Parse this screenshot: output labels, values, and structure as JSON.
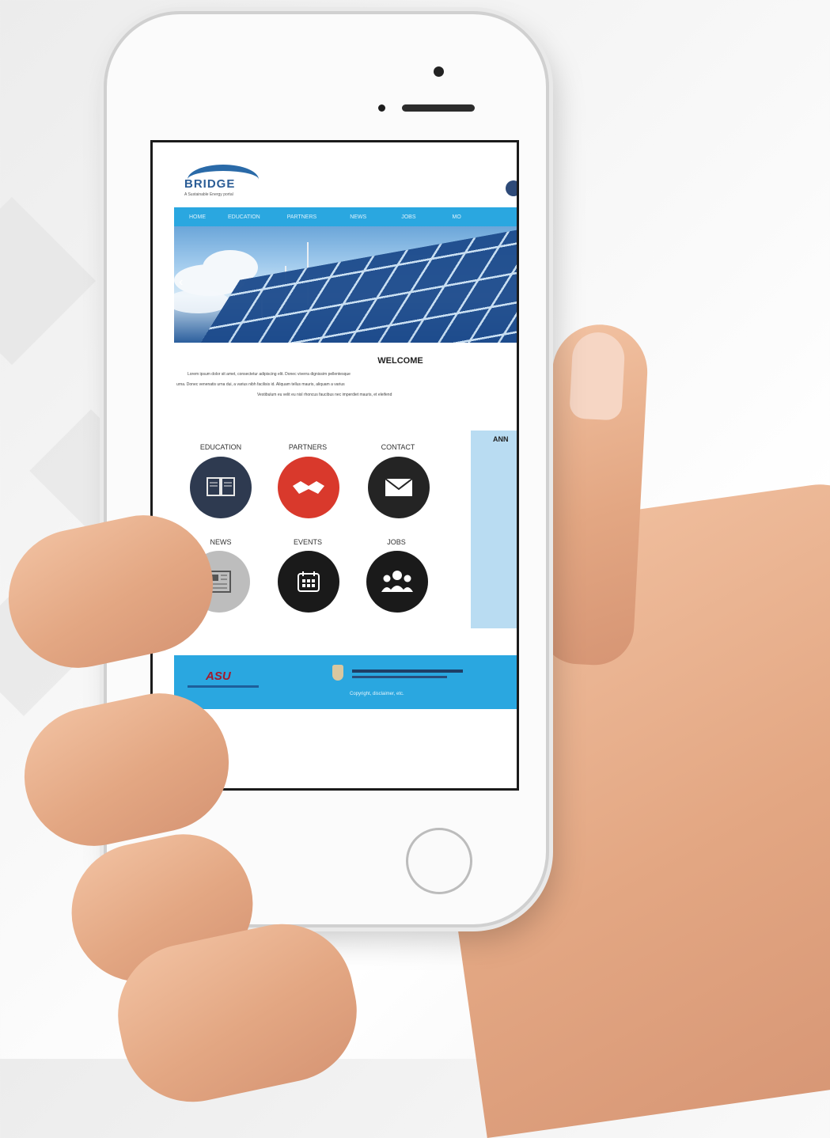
{
  "site": {
    "logo_text": "BRIDGE",
    "logo_subtitle": "A Sustainable Energy portal",
    "nav": [
      "HOME",
      "EDUCATION",
      "PARTNERS",
      "NEWS",
      "JOBS",
      "MO"
    ],
    "welcome": {
      "title": "WELCOME",
      "lines": [
        "Lorem ipsum dolor sit amet, consectetur adipiscing elit. Donec viverra dignissim pellentesque",
        "urna. Donec venenatis urna dui, a varius nibh facilisis id. Aliquam tellus mauris, aliquam a varius",
        "Vestibulum eu velit eu nisl rhoncus faucibus nec imperdiet mauris, et eleifend"
      ]
    },
    "icons": [
      {
        "label": "EDUCATION",
        "icon": "book-icon"
      },
      {
        "label": "PARTNERS",
        "icon": "handshake-icon"
      },
      {
        "label": "CONTACT",
        "icon": "envelope-icon"
      },
      {
        "label": "NEWS",
        "icon": "newspaper-icon"
      },
      {
        "label": "EVENTS",
        "icon": "calendar-icon"
      },
      {
        "label": "JOBS",
        "icon": "people-icon"
      }
    ],
    "announcements_title": "ANN",
    "footer": {
      "asu": "ASU",
      "copyright": "Copyright, disclaimer, etc."
    }
  },
  "colors": {
    "nav_blue": "#2aa7e0",
    "education": "#2e3a50",
    "partners": "#d9392c",
    "contact": "#242424",
    "news": "#bdbdbd",
    "events": "#1a1a1a",
    "jobs": "#1a1a1a"
  }
}
